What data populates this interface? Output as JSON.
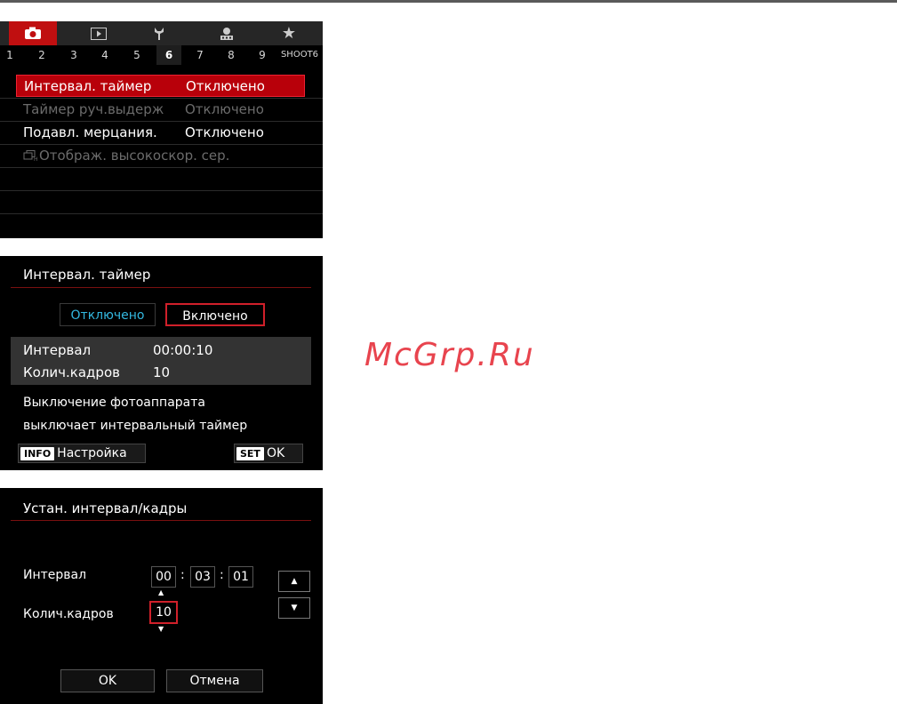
{
  "screen1": {
    "tabs": [
      {
        "icon": "camera-icon",
        "glyph": "◘"
      },
      {
        "icon": "playback-icon",
        "glyph": "▶"
      },
      {
        "icon": "wrench-icon",
        "glyph": "Ұ"
      },
      {
        "icon": "custom-function-icon",
        "glyph": "⚙"
      },
      {
        "icon": "my-menu-star-icon",
        "glyph": "★"
      }
    ],
    "pages": [
      "1",
      "2",
      "3",
      "4",
      "5",
      "6",
      "7",
      "8",
      "9",
      "SHOOT6"
    ],
    "active_page": "6",
    "rows": [
      {
        "label": "Интервал. таймер",
        "value": "Отключено",
        "state": "selected"
      },
      {
        "label": "Таймер руч.выдерж",
        "value": "Отключено",
        "state": "disabled"
      },
      {
        "label": "Подавл. мерцания.",
        "value": "Отключено",
        "state": "normal"
      },
      {
        "label": "Отображ. высокоскор. сер.",
        "value": "",
        "state": "disabled"
      }
    ]
  },
  "screen2": {
    "title": "Интервал. таймер",
    "option_off": "Отключено",
    "option_on": "Включено",
    "interval_label": "Интервал",
    "interval_value": "00:00:10",
    "frames_label": "Колич.кадров",
    "frames_value": "10",
    "note_line1": "Выключение фотоаппарата",
    "note_line2": "выключает интервальный таймер",
    "info_key": "INFO",
    "info_label": "Настройка",
    "set_key": "SET",
    "set_label": "OK"
  },
  "screen3": {
    "title": "Устан. интервал/кадры",
    "interval_label": "Интервал",
    "hours": "00",
    "minutes": "03",
    "seconds": "01",
    "frames_label": "Колич.кадров",
    "frames_value": "10",
    "ok_label": "OK",
    "cancel_label": "Отмена"
  },
  "watermark": "McGrp.Ru"
}
